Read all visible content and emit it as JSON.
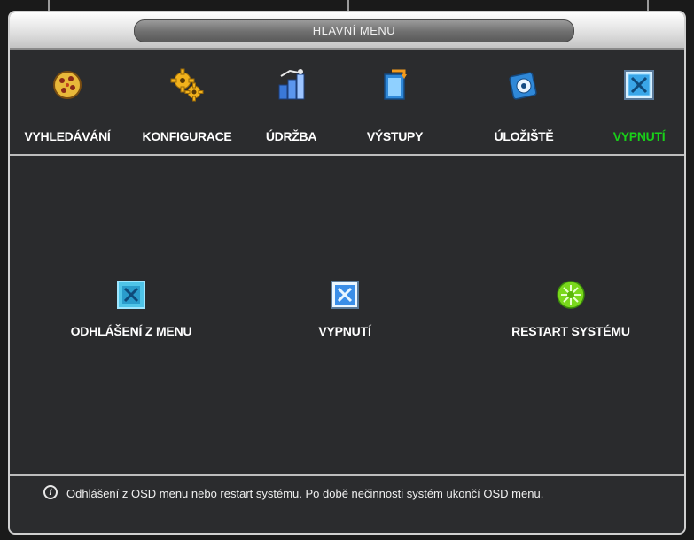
{
  "window": {
    "title": "HLAVNÍ MENU"
  },
  "menu": {
    "items": [
      {
        "label": "VYHLEDÁVÁNÍ",
        "icon": "search-icon",
        "active": false
      },
      {
        "label": "KONFIGURACE",
        "icon": "gears-icon",
        "active": false
      },
      {
        "label": "ÚDRŽBA",
        "icon": "maintenance-icon",
        "active": false
      },
      {
        "label": "VÝSTUPY",
        "icon": "output-icon",
        "active": false
      },
      {
        "label": "ÚLOŽIŠTĚ",
        "icon": "storage-icon",
        "active": false
      },
      {
        "label": "VYPNUTÍ",
        "icon": "shutdown-icon",
        "active": true
      }
    ]
  },
  "actions": [
    {
      "label": "ODHLÁŠENÍ Z MENU",
      "icon": "logout-icon"
    },
    {
      "label": "VYPNUTÍ",
      "icon": "power-off-icon"
    },
    {
      "label": "RESTART SYSTÉMU",
      "icon": "restart-icon"
    }
  ],
  "status": {
    "text": "Odhlášení z OSD menu nebo restart systému. Po době nečinnosti systém ukončí OSD menu."
  },
  "colors": {
    "active": "#19d019",
    "text": "#ffffff",
    "background": "#2a2b2d"
  }
}
